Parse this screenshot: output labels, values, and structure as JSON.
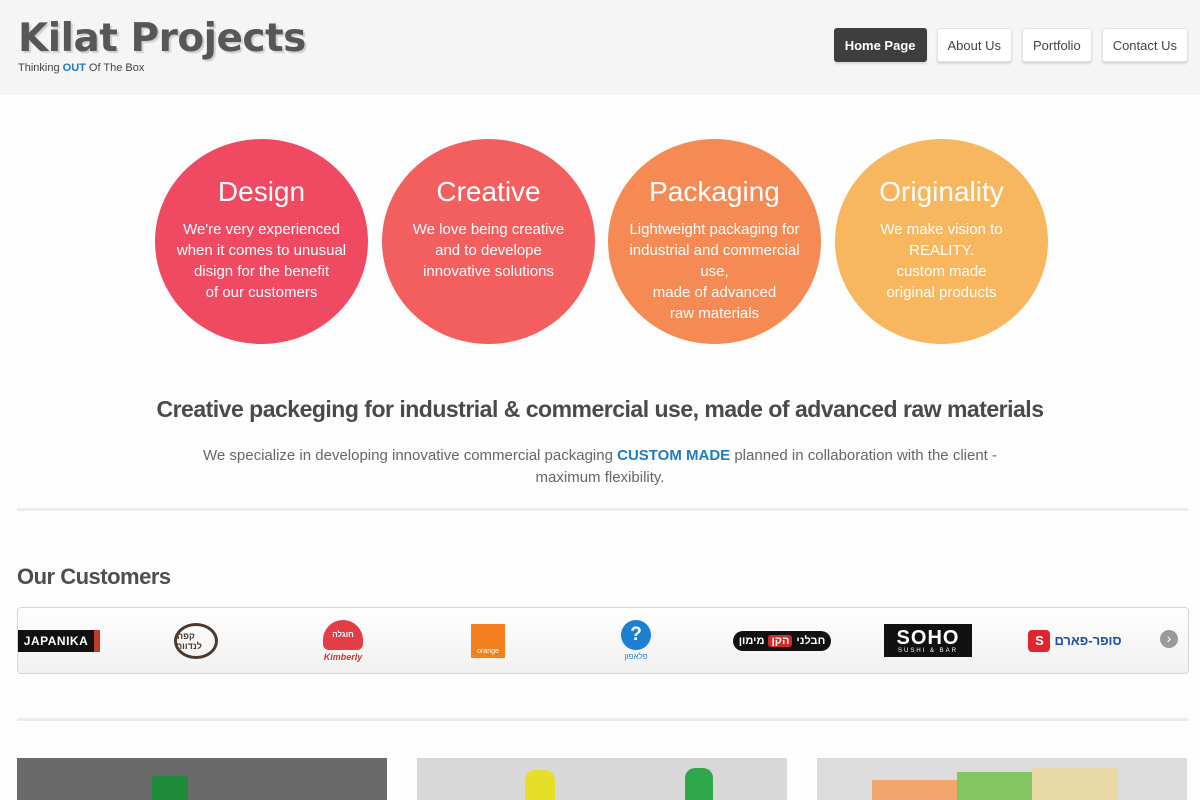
{
  "header": {
    "logo_title": "Kilat Projects",
    "tagline_pre": "Thinking ",
    "tagline_highlight": "OUT",
    "tagline_post": " Of The Box"
  },
  "nav": [
    {
      "label": "Home Page",
      "active": true
    },
    {
      "label": "About Us",
      "active": false
    },
    {
      "label": "Portfolio",
      "active": false
    },
    {
      "label": "Contact Us",
      "active": false
    }
  ],
  "features": [
    {
      "title": "Design",
      "text": "We're very experienced\nwhen it comes to unusual\ndisign for the benefit\nof our customers",
      "color": "#f04a63"
    },
    {
      "title": "Creative",
      "text": "We love being creative\nand to develope\ninnovative solutions",
      "color": "#f35e5f"
    },
    {
      "title": "Packaging",
      "text": "Lightweight packaging for\nindustrial and commercial use,\nmade of advanced\nraw materials",
      "color": "#f58a55"
    },
    {
      "title": "Originality",
      "text": "We make vision to\nREALITY.\ncustom made\noriginal products",
      "color": "#f8b65e"
    }
  ],
  "intro": {
    "heading": "Creative packeging for industrial & commercial use, made of advanced raw materials",
    "text_pre": "We specialize in developing innovative commercial packaging ",
    "text_highlight": "CUSTOM MADE",
    "text_post": " planned in collaboration with the client - maximum flexibility."
  },
  "customers": {
    "title": "Our Customers",
    "logos": {
      "japanika": "JAPANIKA",
      "landver": "קפה לנדוור",
      "kimberly_mark": "חוגלה",
      "kimberly_name": "Kimberly",
      "orange": "orange",
      "pelephone_mark": "?",
      "pelephone_name": "פלאפון",
      "haflanim_left": "חבלני",
      "haflanim_mid": "הקן",
      "haflanim_right": "מימון",
      "soho_big": "SOHO",
      "soho_small": "SUSHI & BAR",
      "superpharm_mark": "S",
      "superpharm_name": "סופר-פארם"
    },
    "next_arrow": "›"
  },
  "colors": {
    "accent": "#1f7cc3",
    "nav_active": "#3e3e3e"
  }
}
